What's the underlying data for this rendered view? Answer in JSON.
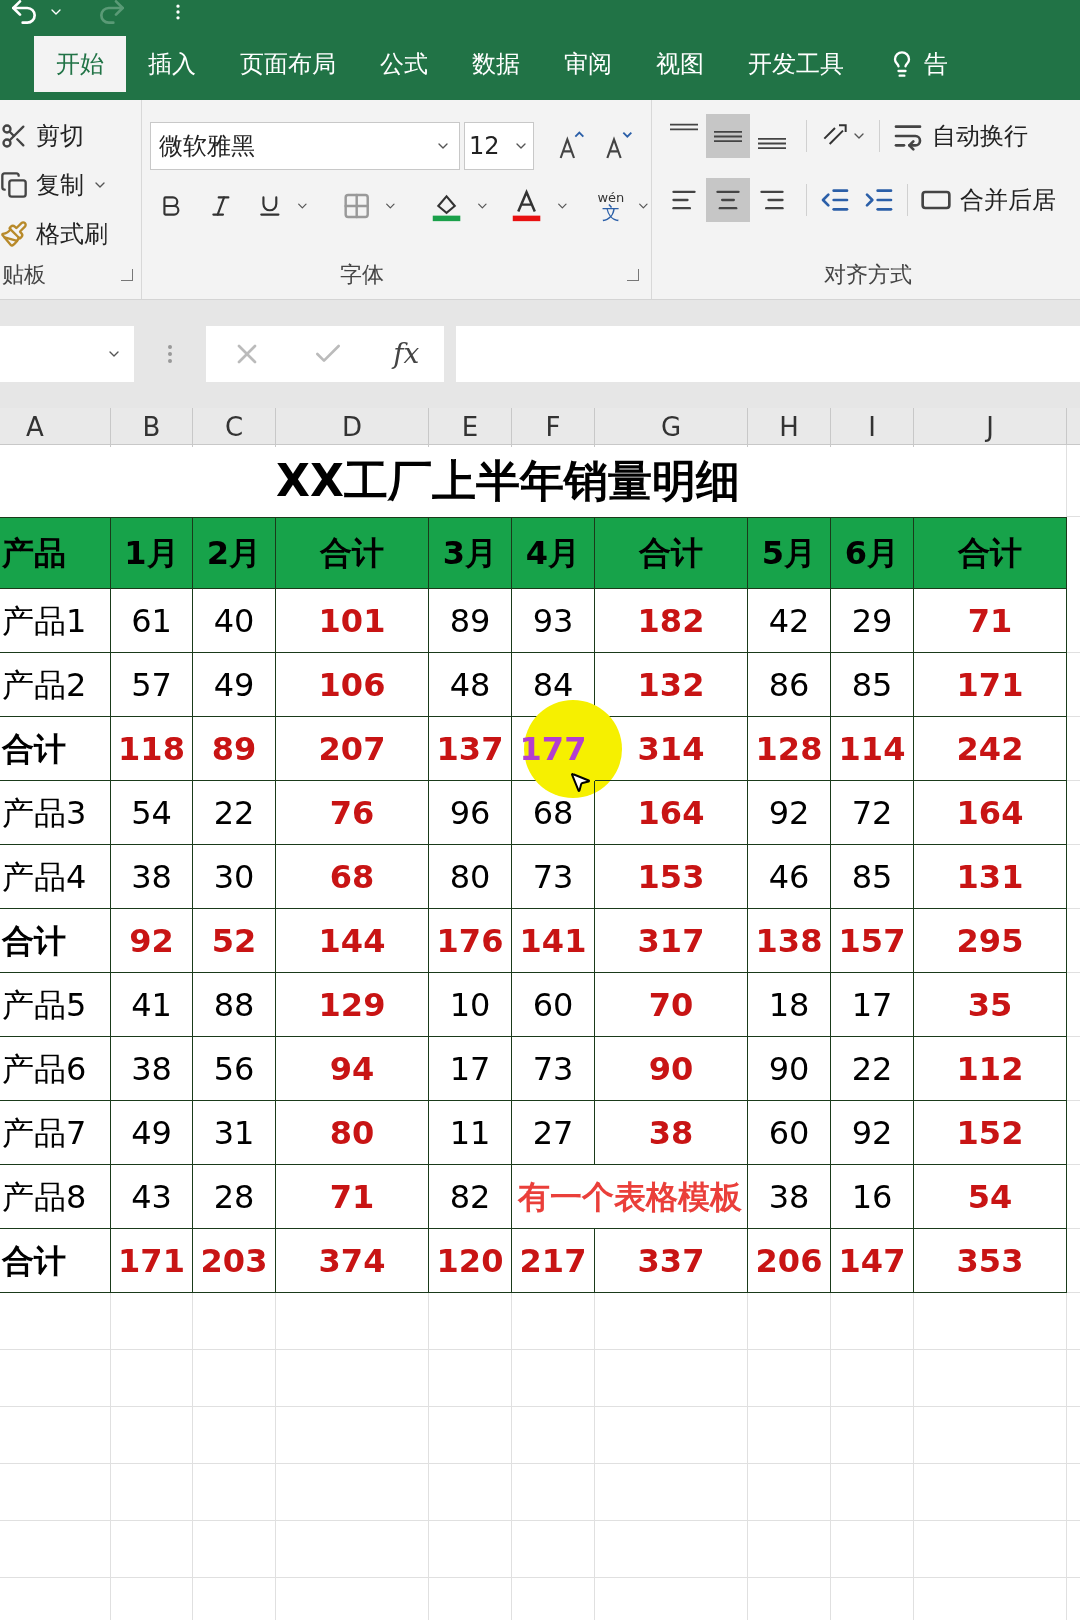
{
  "tabs": [
    {
      "label": "开始",
      "selected": true
    },
    {
      "label": "插入",
      "selected": false
    },
    {
      "label": "页面布局",
      "selected": false
    },
    {
      "label": "公式",
      "selected": false
    },
    {
      "label": "数据",
      "selected": false
    },
    {
      "label": "审阅",
      "selected": false
    },
    {
      "label": "视图",
      "selected": false
    },
    {
      "label": "开发工具",
      "selected": false
    },
    {
      "label": "告",
      "selected": false,
      "kind": "tell"
    }
  ],
  "ribbon": {
    "clipboard": {
      "items": [
        {
          "label": "剪切",
          "kind": "cut"
        },
        {
          "label": "复制",
          "kind": "copy"
        },
        {
          "label": "格式刷",
          "kind": "painter"
        }
      ],
      "label": "贴板"
    },
    "font": {
      "font_name": "微软雅黑",
      "font_size": "12",
      "wen_label": "wén",
      "wen_char": "文",
      "label": "字体"
    },
    "alignment": {
      "vertical": [
        {
          "kind": "top",
          "selected": false
        },
        {
          "kind": "middle",
          "selected": true
        },
        {
          "kind": "bottom",
          "selected": false
        }
      ],
      "horizontal": [
        {
          "kind": "left",
          "selected": false
        },
        {
          "kind": "center",
          "selected": true
        },
        {
          "kind": "right",
          "selected": false
        }
      ],
      "wrap_text": "自动换行",
      "merge_center": "合并后居",
      "label": "对齐方式"
    }
  },
  "formula_bar": {
    "fx": "fx"
  },
  "columns": [
    "A",
    "B",
    "C",
    "D",
    "E",
    "F",
    "G",
    "H",
    "I",
    "J"
  ],
  "sheet_title": "XX工厂上半年销量明细",
  "header": [
    {
      "label": "产品",
      "kind": "label"
    },
    {
      "label": "1月",
      "kind": "month"
    },
    {
      "label": "2月",
      "kind": "month"
    },
    {
      "label": "合计",
      "kind": "sum"
    },
    {
      "label": "3月",
      "kind": "month"
    },
    {
      "label": "4月",
      "kind": "month"
    },
    {
      "label": "合计",
      "kind": "sum"
    },
    {
      "label": "5月",
      "kind": "month"
    },
    {
      "label": "6月",
      "kind": "month"
    },
    {
      "label": "合计",
      "kind": "sum"
    }
  ],
  "rows": [
    {
      "kind": "product",
      "cells": [
        "产品1",
        "61",
        "40",
        "101",
        "89",
        "93",
        "182",
        "42",
        "29",
        "71"
      ]
    },
    {
      "kind": "product",
      "cells": [
        "产品2",
        "57",
        "49",
        "106",
        "48",
        "84",
        "132",
        "86",
        "85",
        "171"
      ]
    },
    {
      "kind": "total",
      "cells": [
        "合计",
        "118",
        "89",
        "207",
        "137",
        {
          "text": "177",
          "pointer": true
        },
        "314",
        "128",
        "114",
        "242"
      ]
    },
    {
      "kind": "product",
      "cells": [
        "产品3",
        "54",
        "22",
        "76",
        "96",
        "68",
        "164",
        "92",
        "72",
        "164"
      ]
    },
    {
      "kind": "product",
      "cells": [
        "产品4",
        "38",
        "30",
        "68",
        "80",
        "73",
        "153",
        "46",
        "85",
        "131"
      ]
    },
    {
      "kind": "total",
      "cells": [
        "合计",
        "92",
        "52",
        "144",
        "176",
        "141",
        "317",
        "138",
        "157",
        "295"
      ]
    },
    {
      "kind": "product",
      "cells": [
        "产品5",
        "41",
        "88",
        "129",
        "10",
        "60",
        "70",
        "18",
        "17",
        "35"
      ]
    },
    {
      "kind": "product",
      "cells": [
        "产品6",
        "38",
        "56",
        "94",
        "17",
        "73",
        "90",
        "90",
        "22",
        "112"
      ]
    },
    {
      "kind": "product",
      "cells": [
        "产品7",
        "49",
        "31",
        "80",
        "11",
        "27",
        "38",
        "60",
        "92",
        "152"
      ]
    },
    {
      "kind": "product",
      "cells": [
        "产品8",
        "43",
        "28",
        "71",
        "82",
        null,
        null,
        "38",
        "16",
        "54"
      ]
    },
    {
      "kind": "total",
      "cells": [
        "合计",
        "171",
        "203",
        "374",
        "120",
        "217",
        "337",
        "206",
        "147",
        "353"
      ]
    }
  ],
  "caption": "有一个表格模板"
}
